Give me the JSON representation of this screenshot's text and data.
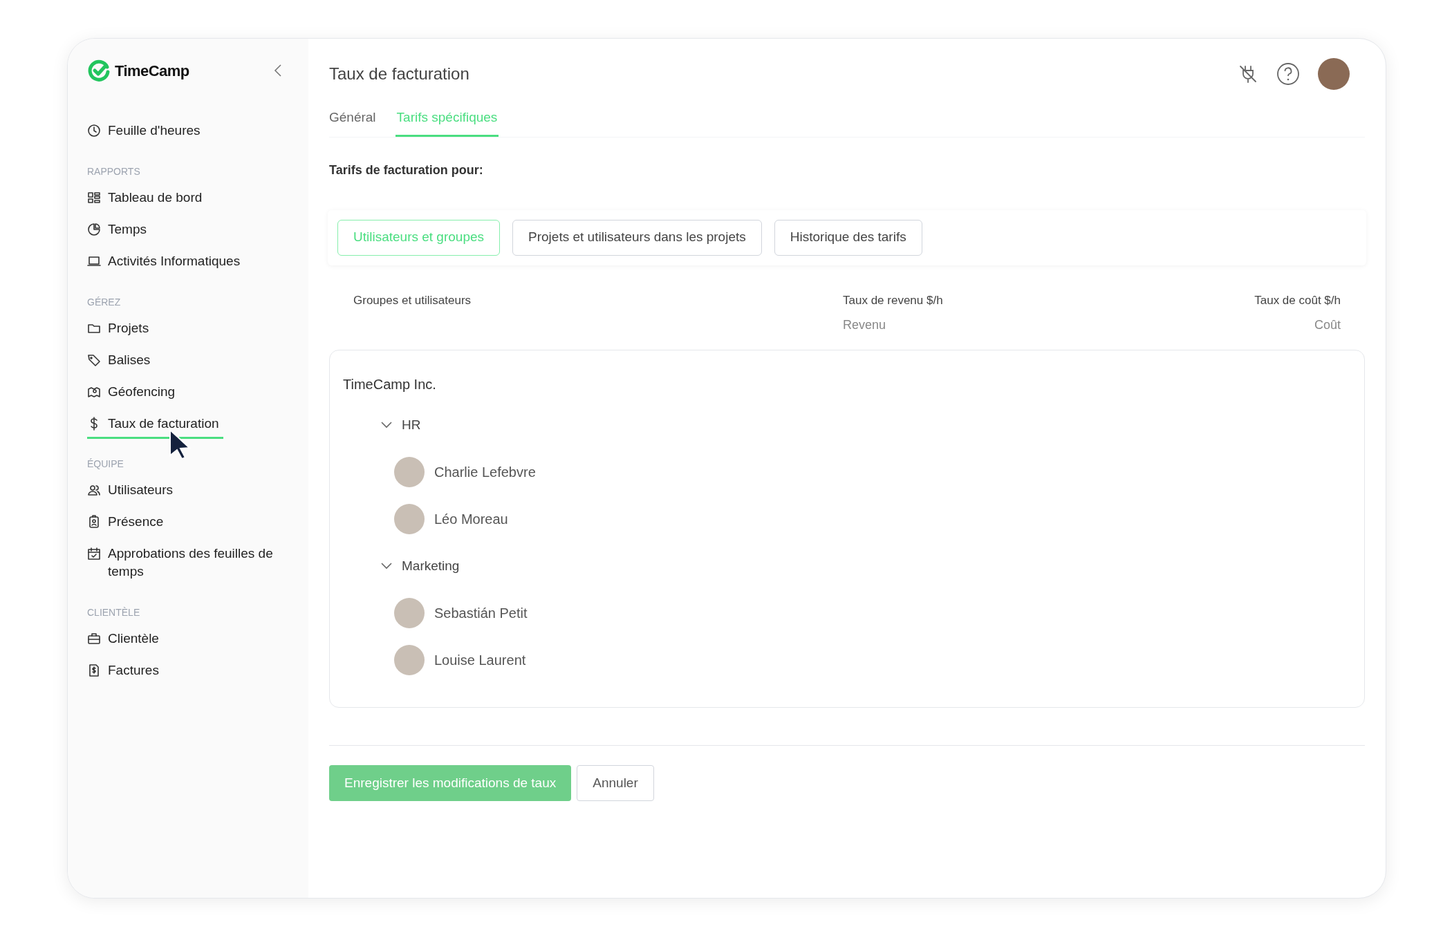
{
  "sidebar": {
    "logo": "TimeCamp",
    "sections": [
      {
        "items": [
          {
            "label": "Feuille d'heures",
            "selected": false
          }
        ]
      },
      {
        "heading": "RAPPORTS",
        "items": [
          {
            "label": "Tableau de bord",
            "selected": false
          },
          {
            "label": "Temps",
            "selected": false
          },
          {
            "label": "Activités Informatiques",
            "selected": false
          }
        ]
      },
      {
        "heading": "GÉREZ",
        "items": [
          {
            "label": "Projets",
            "selected": false
          },
          {
            "label": "Balises",
            "selected": false
          },
          {
            "label": "Géofencing",
            "selected": false
          },
          {
            "label": "Taux de facturation",
            "selected": true
          }
        ]
      },
      {
        "heading": "ÉQUIPE",
        "items": [
          {
            "label": "Utilisateurs",
            "selected": false
          },
          {
            "label": "Présence",
            "selected": false
          },
          {
            "label": "Approbations des feuilles de temps",
            "selected": false
          }
        ]
      },
      {
        "heading": "CLIENTÈLE",
        "items": [
          {
            "label": "Clientèle",
            "selected": false
          },
          {
            "label": "Factures",
            "selected": false
          }
        ]
      }
    ]
  },
  "page": {
    "title": "Taux de facturation",
    "tabs": [
      {
        "label": "Général",
        "selected": false
      },
      {
        "label": "Tarifs spécifiques",
        "selected": true
      }
    ],
    "subtitle": "Tarifs de facturation pour:",
    "filters": [
      {
        "label": "Utilisateurs et groupes",
        "selected": true
      },
      {
        "label": "Projets et utilisateurs dans les projets",
        "selected": false
      },
      {
        "label": "Historique des tarifs",
        "selected": false
      }
    ],
    "table": {
      "columns": [
        {
          "label": "Groupes et utilisateurs"
        },
        {
          "label": "Taux de revenu $/h",
          "sublabel": "Revenu"
        },
        {
          "label": "Taux de coût $/h",
          "sublabel": "Coût"
        }
      ],
      "tree": [
        {
          "kind": "company",
          "label": "TimeCamp Inc.",
          "children": [
            {
              "kind": "group",
              "label": "HR",
              "expanded": true,
              "children": [
                {
                  "kind": "user",
                  "label": "Charlie Lefebvre"
                },
                {
                  "kind": "user",
                  "label": "Léo Moreau"
                }
              ]
            },
            {
              "kind": "group",
              "label": "Marketing",
              "expanded": true,
              "children": [
                {
                  "kind": "user",
                  "label": "Sebastián Petit"
                },
                {
                  "kind": "user",
                  "label": "Louise Laurent"
                }
              ]
            }
          ]
        }
      ]
    },
    "save_button": "Enregistrer les modifications de taux",
    "cancel_button": "Annuler"
  }
}
